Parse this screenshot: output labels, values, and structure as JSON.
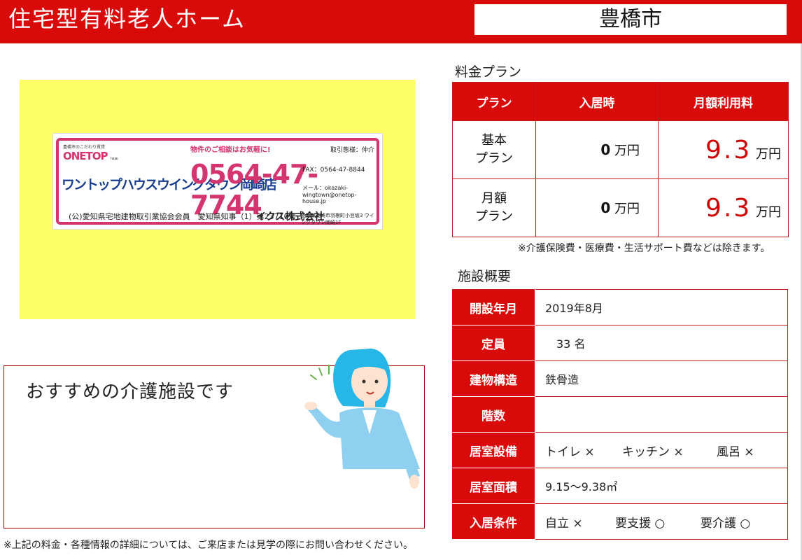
{
  "header": {
    "title": "住宅型有料老人ホーム",
    "city": "豊橋市"
  },
  "banner": {
    "sub": "豊橋市のこだわり賃貸",
    "logo": "ONETOP",
    "logo_small": "house",
    "note": "物件のご相談はお気軽に!",
    "deal": "取引態様：仲介",
    "shop": "ワントップハウスウイングタウン岡崎店",
    "phone": "0564-47-7744",
    "fax": "FAX：0564-47-8844",
    "mail": "メール：okazaki-wingtown@onetop-house.jp",
    "assoc": "(公)愛知県宅地建物取引業協会会員　愛知県知事（1）第23710号",
    "company": "イクス株式会社",
    "address": "愛知県岡崎市羽根町小豆坂3 ウイングタウン岡崎1F"
  },
  "recommend": {
    "text": "おすすめの介護施設です"
  },
  "price": {
    "section_label": "料金プラン",
    "headers": [
      "プラン",
      "入居時",
      "月額利用料"
    ],
    "rows": [
      {
        "plan_line1": "基本",
        "plan_line2": "プラン",
        "move_in_num": "0",
        "move_in_unit": "万円",
        "monthly_num": "9.3",
        "monthly_unit": "万円"
      },
      {
        "plan_line1": "月額",
        "plan_line2": "プラン",
        "move_in_num": "0",
        "move_in_unit": "万円",
        "monthly_num": "9.3",
        "monthly_unit": "万円"
      }
    ],
    "note": "※介護保険費・医療費・生活サポート費などは除きます。"
  },
  "facility": {
    "section_label": "施設概要",
    "rows": [
      {
        "label": "開設年月",
        "value": "2019年8月"
      },
      {
        "label": "定員",
        "value": "　33 名"
      },
      {
        "label": "建物構造",
        "value": "鉄骨造"
      },
      {
        "label": "階数",
        "value": ""
      },
      {
        "label": "居室設備",
        "items": [
          "トイレ ×",
          "キッチン ×",
          "風呂 ×"
        ]
      },
      {
        "label": "居室面積",
        "value": "9.15～9.38㎡"
      },
      {
        "label": "入居条件",
        "items": [
          "自立 ×",
          "要支援 ○",
          "要介護 ○"
        ]
      }
    ]
  },
  "footnote": "※上記の料金・各種情報の詳細については、ご来店または見学の際にお問い合わせください。",
  "colors": {
    "accent": "#d90a0a",
    "highlight": "#ffff66",
    "brand_pink": "#d4356f",
    "brand_navy": "#1a3d8f"
  }
}
